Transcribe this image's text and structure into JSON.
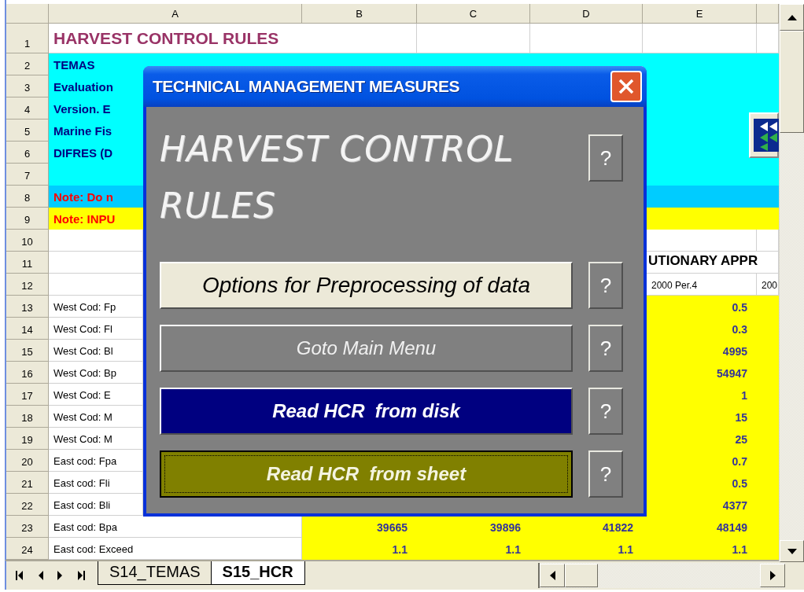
{
  "sheet": {
    "columns": [
      "A",
      "B",
      "C",
      "D",
      "E"
    ],
    "rows": [
      {
        "number": "1",
        "kind": "title",
        "cells": {
          "A": "HARVEST CONTROL RULES"
        }
      },
      {
        "number": "2",
        "kind": "info",
        "cells": {
          "A": "TEMAS"
        }
      },
      {
        "number": "3",
        "kind": "info",
        "cells": {
          "A": "Evaluation"
        }
      },
      {
        "number": "4",
        "kind": "info",
        "cells": {
          "A": "Version. E"
        }
      },
      {
        "number": "5",
        "kind": "info",
        "cells": {
          "A": "Marine Fis"
        }
      },
      {
        "number": "6",
        "kind": "info",
        "cells": {
          "A": "DIFRES (D"
        }
      },
      {
        "number": "7",
        "kind": "info"
      },
      {
        "number": "8",
        "kind": "warning",
        "cells": {
          "A": "Note: Do n"
        }
      },
      {
        "number": "9",
        "kind": "input-note",
        "cells": {
          "A": "Note: INPU"
        }
      },
      {
        "number": "10",
        "kind": "blank"
      },
      {
        "number": "11",
        "kind": "heading",
        "cells": {
          "E": "UTIONARY APPR"
        }
      },
      {
        "number": "12",
        "kind": "blank",
        "cells": {
          "E": "2000 Per.4",
          "column_6": "200"
        }
      },
      {
        "number": "13",
        "kind": "data",
        "cells": {
          "A": "West Cod: Fp",
          "E": "0.5"
        }
      },
      {
        "number": "14",
        "kind": "data",
        "cells": {
          "A": "West Cod: Fl",
          "E": "0.3"
        }
      },
      {
        "number": "15",
        "kind": "data",
        "cells": {
          "A": "West Cod: Bl",
          "E": "4995"
        }
      },
      {
        "number": "16",
        "kind": "data",
        "cells": {
          "A": "West Cod: Bp",
          "E": "54947"
        }
      },
      {
        "number": "17",
        "kind": "data",
        "cells": {
          "A": "West Cod: E",
          "E": "1"
        }
      },
      {
        "number": "18",
        "kind": "data",
        "cells": {
          "A": "West Cod: M",
          "E": "15"
        }
      },
      {
        "number": "19",
        "kind": "data",
        "cells": {
          "A": "West Cod: M",
          "E": "25"
        }
      },
      {
        "number": "20",
        "kind": "data",
        "cells": {
          "A": "East cod: Fpa",
          "E": "0.7"
        }
      },
      {
        "number": "21",
        "kind": "data",
        "cells": {
          "A": "East cod: Fli",
          "E": "0.5"
        }
      },
      {
        "number": "22",
        "kind": "data",
        "cells": {
          "A": "East cod: Bli",
          "E": "4377"
        }
      },
      {
        "number": "23",
        "kind": "data",
        "cells": {
          "A": "East cod: Bpa",
          "B": "39665",
          "C": "39896",
          "D": "41822",
          "E": "48149"
        }
      },
      {
        "number": "24",
        "kind": "data",
        "cells": {
          "A": "East cod: Exceed",
          "B": "1.1",
          "C": "1.1",
          "D": "1.1",
          "E": "1.1"
        }
      }
    ]
  },
  "dialog": {
    "title": "TECHNICAL MANAGEMENT MEASURES",
    "heading": "HARVEST CONTROL RULES",
    "heading_help": "?",
    "buttons": [
      {
        "label": "Options for Preprocessing of data",
        "kind": "light",
        "focused": false,
        "help": "?"
      },
      {
        "label": "Goto Main Menu",
        "kind": "grey",
        "focused": false,
        "help": "?"
      },
      {
        "label": "Read HCR  from disk",
        "kind": "navy",
        "focused": false,
        "help": "?"
      },
      {
        "label": "Read HCR  from sheet",
        "kind": "olive",
        "focused": true,
        "help": "?"
      }
    ]
  },
  "sheet_tabs": [
    {
      "label": "S14_TEMAS",
      "selected": false
    },
    {
      "label": "S15_HCR",
      "selected": true
    }
  ]
}
